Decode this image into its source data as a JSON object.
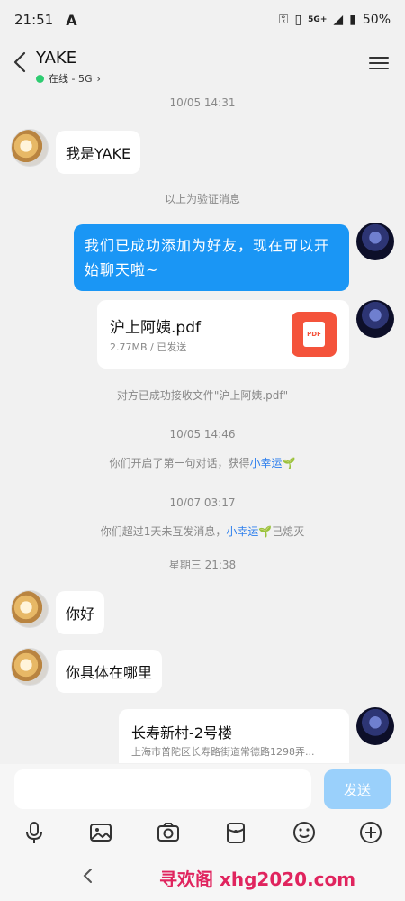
{
  "status_bar": {
    "time": "21:51",
    "network": "5G+",
    "battery": "50%"
  },
  "header": {
    "title": "YAKE",
    "subtitle": "在线 - 5G"
  },
  "messages": {
    "ts1": "10/05 14:31",
    "m1": "我是YAKE",
    "note1": "以上为验证消息",
    "m2": "我们已成功添加为好友，现在可以开始聊天啦~",
    "file": {
      "name": "沪上阿姨.pdf",
      "meta": "2.77MB / 已发送",
      "icon_label": "PDF"
    },
    "note2": "对方已成功接收文件\"沪上阿姨.pdf\"",
    "ts2": "10/05 14:46",
    "note3": {
      "prefix": "你们开启了第一句对话，获得",
      "link": "小幸运"
    },
    "ts3": "10/07 03:17",
    "note4": {
      "prefix": "你们超过1天未互发消息，",
      "link": "小幸运",
      "suffix": "已熄灭"
    },
    "ts4": "星期三 21:38",
    "m3": "你好",
    "m4": "你具体在哪里",
    "location": {
      "title": "长寿新村-2号楼",
      "address": "上海市普陀区长寿路街道常德路1298弄..."
    }
  },
  "input": {
    "value": "",
    "send_label": "发送"
  },
  "watermark": "寻欢阁 xhg2020.com"
}
